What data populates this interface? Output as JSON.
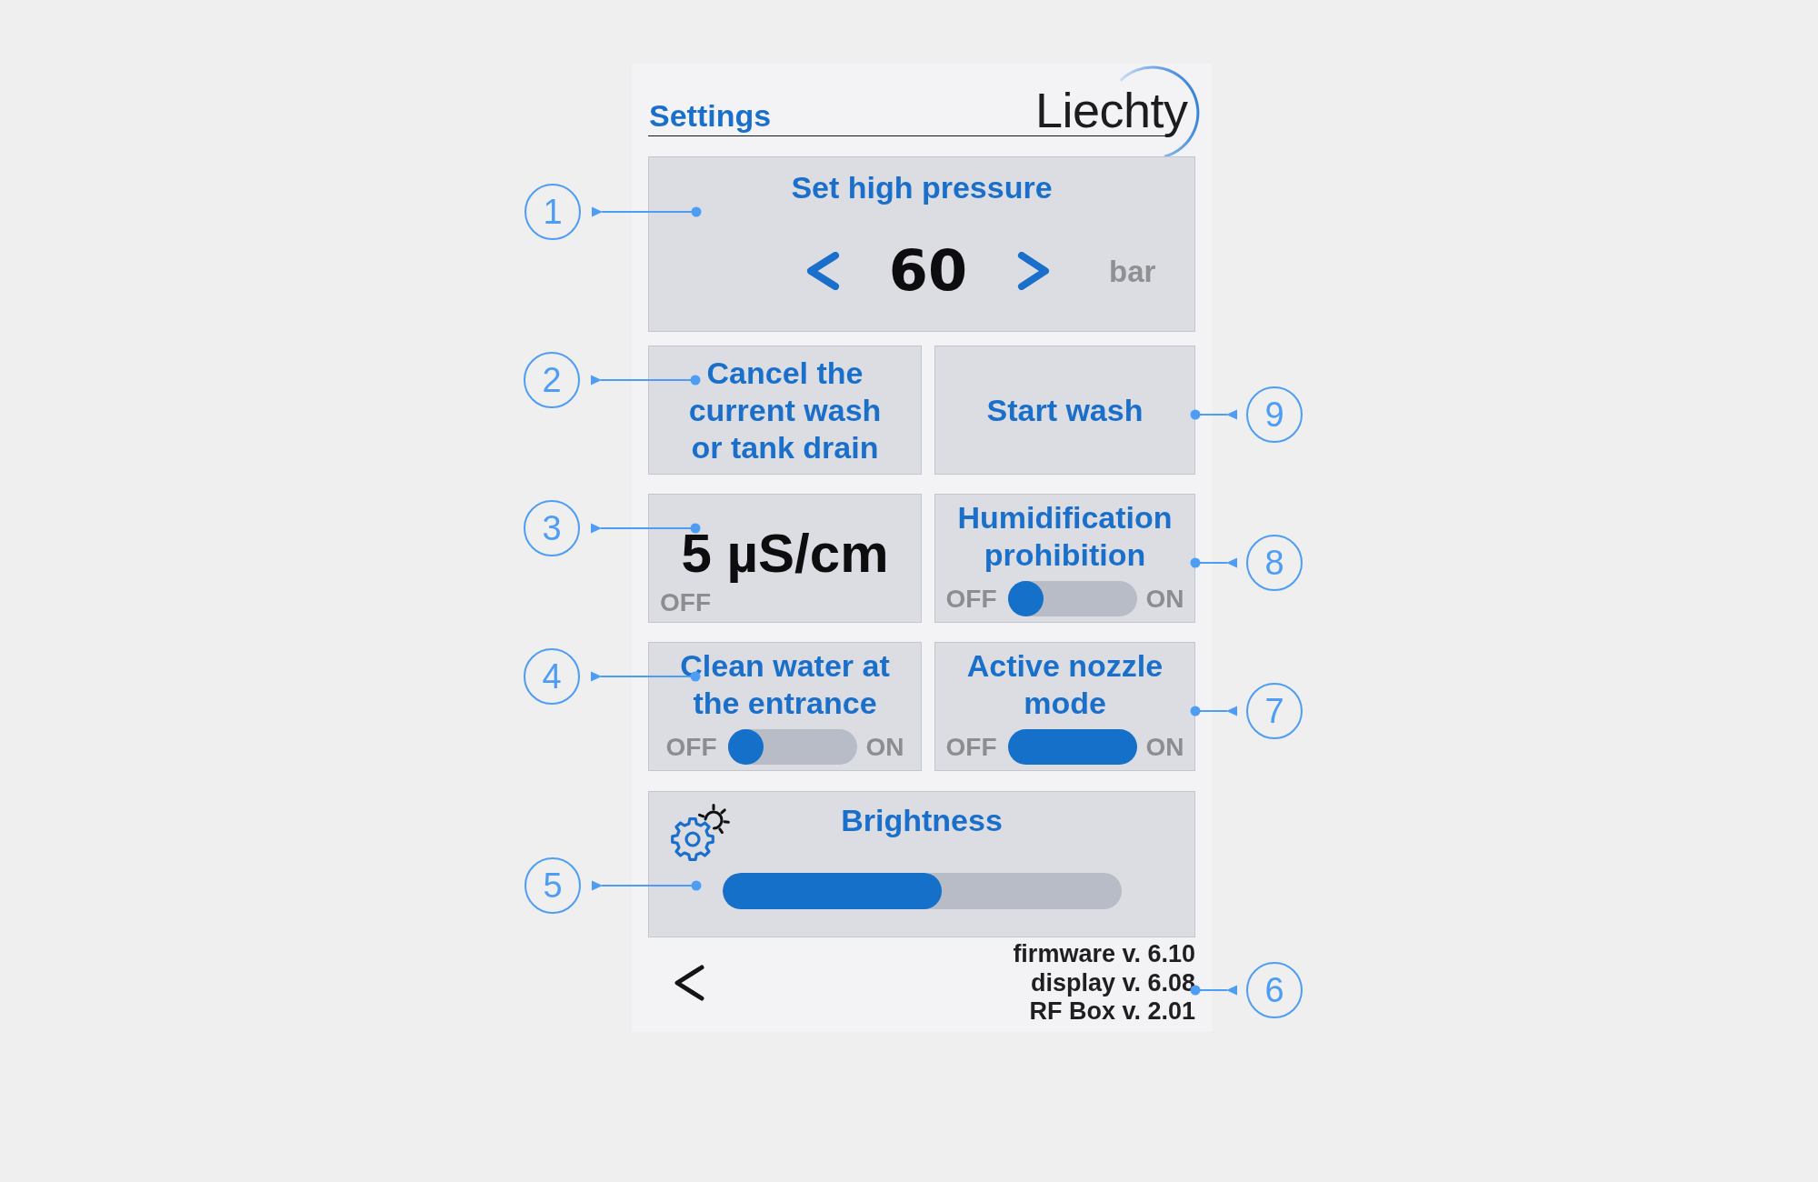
{
  "header": {
    "title": "Settings",
    "logo": "Liechty"
  },
  "pressure": {
    "title": "Set high pressure",
    "value": "60",
    "unit": "bar",
    "callout": "1"
  },
  "tiles": [
    {
      "kind": "button",
      "label": "Cancel the current wash or tank drain",
      "callout": "2"
    },
    {
      "kind": "button",
      "label": "Start wash",
      "callout": "9"
    },
    {
      "kind": "reading",
      "value": "5 µS/cm",
      "status": "OFF",
      "callout": "3"
    },
    {
      "kind": "switch",
      "label": "Humidification prohibition",
      "off_label": "OFF",
      "on_label": "ON",
      "on": false,
      "callout": "8"
    },
    {
      "kind": "switch",
      "label": "Clean water at the entrance",
      "off_label": "OFF",
      "on_label": "ON",
      "on": false,
      "callout": "4"
    },
    {
      "kind": "switch",
      "label": "Active nozzle mode",
      "off_label": "OFF",
      "on_label": "ON",
      "on": true,
      "callout": "7"
    }
  ],
  "brightness": {
    "title": "Brightness",
    "level": 0.55,
    "callout": "5"
  },
  "footer": {
    "versions": [
      "firmware v. 6.10",
      "display v. 6.08",
      "RF Box v. 2.01"
    ],
    "callout": "6"
  }
}
